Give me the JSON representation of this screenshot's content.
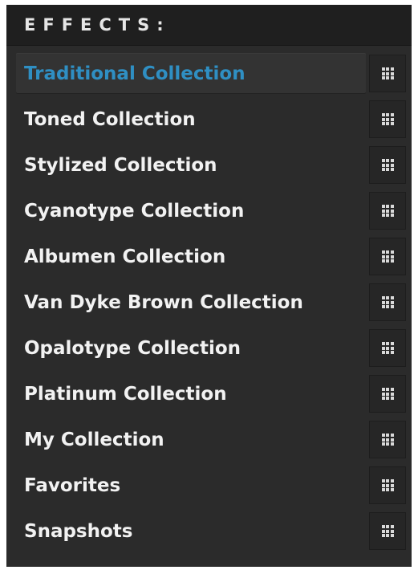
{
  "panel": {
    "title": "EFFECTS:",
    "accent_color": "#2f8fc3",
    "background_color": "#2b2b2b",
    "items": [
      {
        "label": "Traditional Collection",
        "selected": true,
        "icon": "grid-view-icon"
      },
      {
        "label": "Toned Collection",
        "selected": false,
        "icon": "grid-view-icon"
      },
      {
        "label": "Stylized Collection",
        "selected": false,
        "icon": "grid-view-icon"
      },
      {
        "label": "Cyanotype Collection",
        "selected": false,
        "icon": "grid-view-icon"
      },
      {
        "label": "Albumen Collection",
        "selected": false,
        "icon": "grid-view-icon"
      },
      {
        "label": "Van Dyke Brown Collection",
        "selected": false,
        "icon": "grid-view-icon"
      },
      {
        "label": "Opalotype Collection",
        "selected": false,
        "icon": "grid-view-icon"
      },
      {
        "label": "Platinum Collection",
        "selected": false,
        "icon": "grid-view-icon"
      },
      {
        "label": "My Collection",
        "selected": false,
        "icon": "grid-view-icon"
      },
      {
        "label": "Favorites",
        "selected": false,
        "icon": "grid-view-icon"
      },
      {
        "label": "Snapshots",
        "selected": false,
        "icon": "grid-view-icon"
      }
    ]
  }
}
